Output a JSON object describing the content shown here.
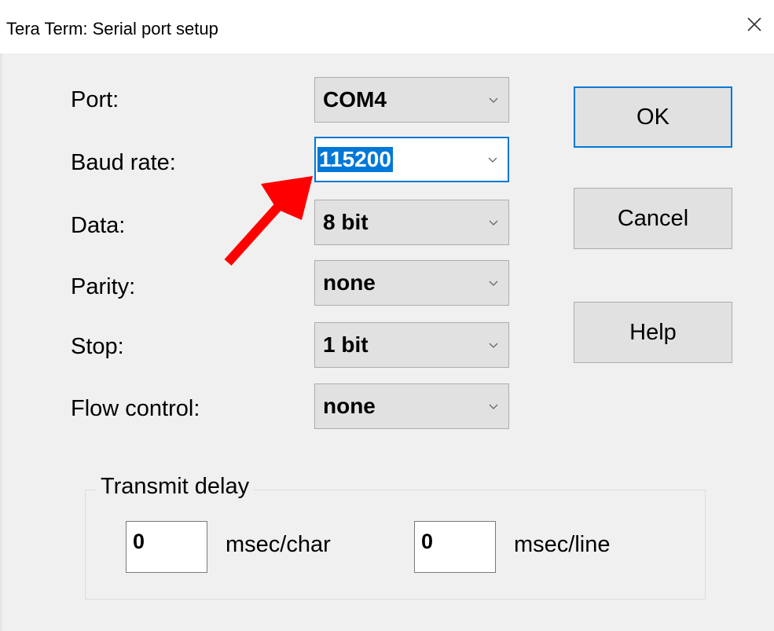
{
  "window": {
    "title": "Tera Term: Serial port setup"
  },
  "fields": [
    {
      "label": "Port:",
      "value": "COM4"
    },
    {
      "label": "Baud rate:",
      "value": "115200"
    },
    {
      "label": "Data:",
      "value": "8 bit"
    },
    {
      "label": "Parity:",
      "value": "none"
    },
    {
      "label": "Stop:",
      "value": "1 bit"
    },
    {
      "label": "Flow control:",
      "value": "none"
    }
  ],
  "buttons": {
    "ok": "OK",
    "cancel": "Cancel",
    "help": "Help"
  },
  "transmit_delay": {
    "title": "Transmit delay",
    "char_value": "0",
    "char_unit": "msec/char",
    "line_value": "0",
    "line_unit": "msec/line"
  },
  "icons": {
    "close": "close-icon",
    "chevron": "chevron-down-icon",
    "annotation_arrow": "red-arrow"
  },
  "colors": {
    "accent": "#0078d7",
    "annotation": "#ff0000",
    "dialog_bg": "#f0f0f0",
    "control_bg": "#e1e1e1"
  }
}
